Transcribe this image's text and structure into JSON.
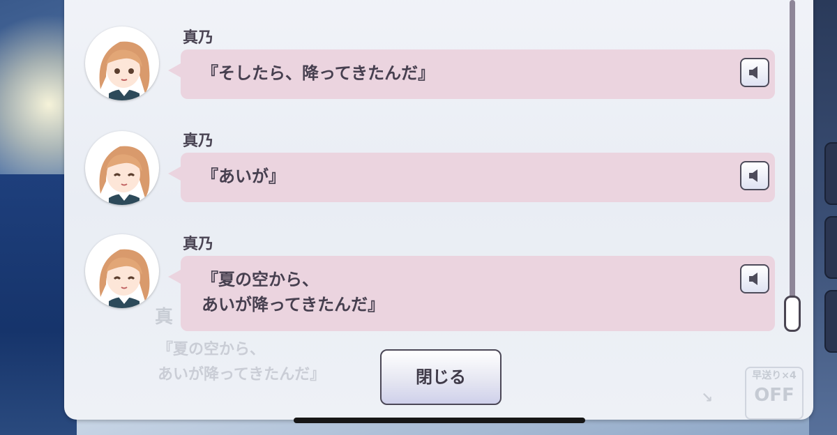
{
  "log": {
    "entries": [
      {
        "speaker": "真乃",
        "line": "『そしたら、降ってきたんだ』",
        "voice_icon": "speaker-icon"
      },
      {
        "speaker": "真乃",
        "line": "『あいが』",
        "voice_icon": "speaker-icon"
      },
      {
        "speaker": "真乃",
        "line": "『夏の空から、\nあいが降ってきたんだ』",
        "voice_icon": "speaker-icon"
      }
    ],
    "close_label": "閉じる"
  },
  "background_dialog": {
    "line": "『夏の空から、\nあいが降ってきたんだ』",
    "skip_label": "早送り×4",
    "skip_state": "OFF"
  },
  "colors": {
    "bubble": "#ebd4df",
    "text": "#463f4f",
    "panel": "#eef1f6"
  }
}
